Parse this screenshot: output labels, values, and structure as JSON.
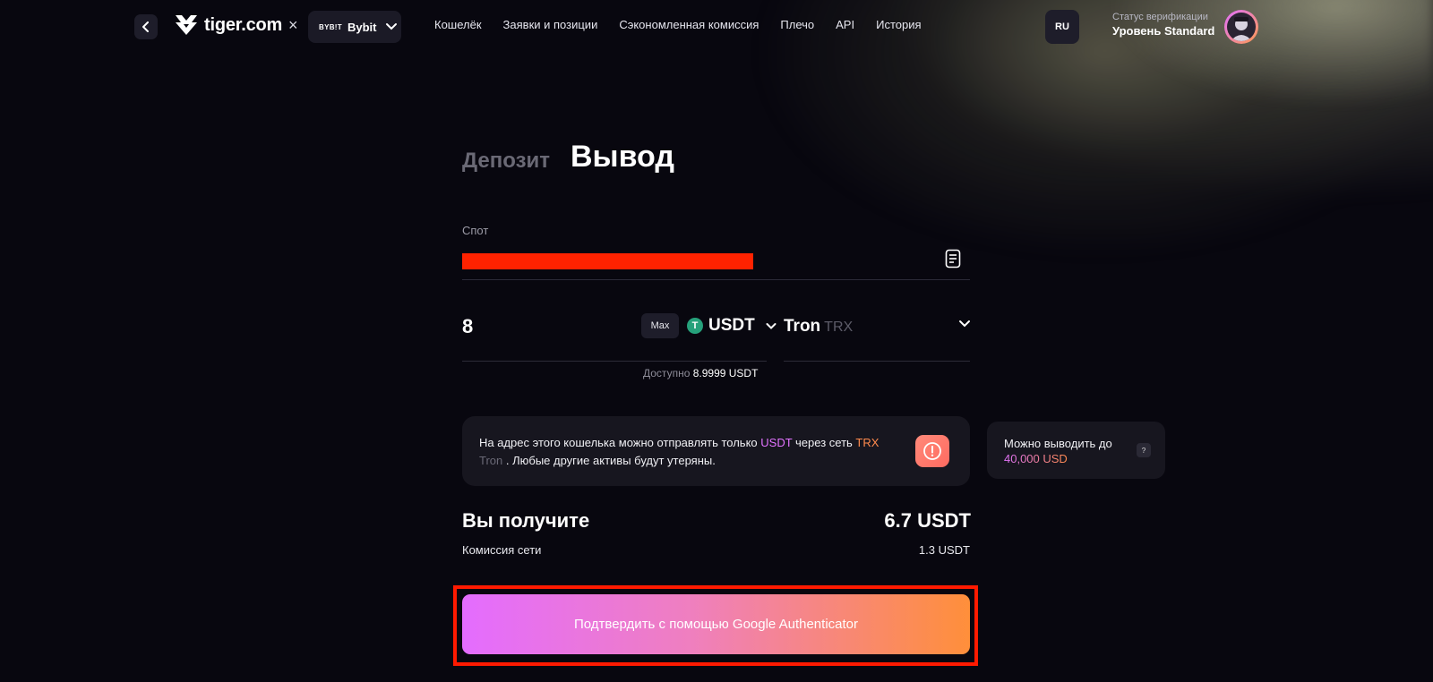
{
  "header": {
    "brand": "tiger.com",
    "separator": "×",
    "exchange": {
      "logo_text": "BYB!T",
      "name": "Bybit"
    },
    "nav": [
      "Кошелёк",
      "Заявки и позиции",
      "Сэкономленная комиссия",
      "Плечо",
      "API",
      "История"
    ],
    "language": "RU",
    "verification": {
      "label": "Статус верификации",
      "level": "Уровень Standard"
    }
  },
  "tabs": {
    "deposit": "Депозит",
    "withdraw": "Вывод"
  },
  "form": {
    "account_label": "Спот",
    "amount": "8",
    "max_label": "Max",
    "coin": {
      "icon_letter": "T",
      "symbol": "USDT"
    },
    "available_label": "Доступно",
    "available_value": "8.9999 USDT",
    "network": {
      "name": "Tron",
      "symbol": "TRX"
    }
  },
  "info": {
    "part1": "На адрес этого кошелька можно отправлять только ",
    "coin": "USDT",
    "part2": " через сеть ",
    "net_symbol": "TRX",
    "net_name": "Tron",
    "part3": " . Любые другие активы будут утеряны."
  },
  "limit": {
    "text": "Можно выводить до",
    "value": "40,000 USD",
    "help": "?"
  },
  "receive": {
    "title": "Вы получите",
    "value": "6.7 USDT",
    "fee_label": "Комиссия сети",
    "fee_value": "1.3 USDT"
  },
  "confirm_label": "Подтвердить с помощью Google Authenticator",
  "colors": {
    "accent_pink": "#e273ff",
    "accent_orange": "#ff8a4d",
    "background": "#08070f",
    "highlight_red": "#ff1a00"
  }
}
